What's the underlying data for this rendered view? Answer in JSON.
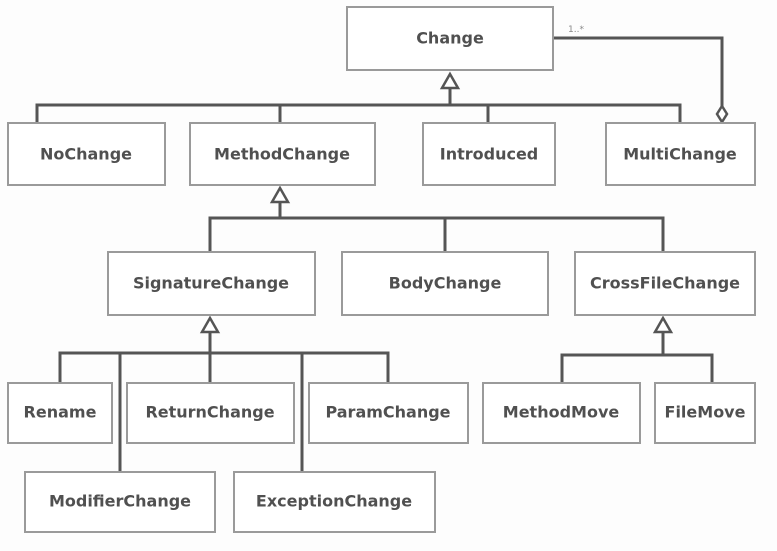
{
  "classes": {
    "change": "Change",
    "no_change": "NoChange",
    "method_change": "MethodChange",
    "introduced": "Introduced",
    "multi_change": "MultiChange",
    "signature_change": "SignatureChange",
    "body_change": "BodyChange",
    "cross_file_change": "CrossFileChange",
    "rename": "Rename",
    "return_change": "ReturnChange",
    "param_change": "ParamChange",
    "modifier_change": "ModifierChange",
    "exception_change": "ExceptionChange",
    "method_move": "MethodMove",
    "file_move": "FileMove"
  },
  "aggregation": {
    "multiplicity": "1..*"
  },
  "colors": {
    "line": "#555555",
    "box_border": "#9a9a9a",
    "text": "#505050"
  }
}
